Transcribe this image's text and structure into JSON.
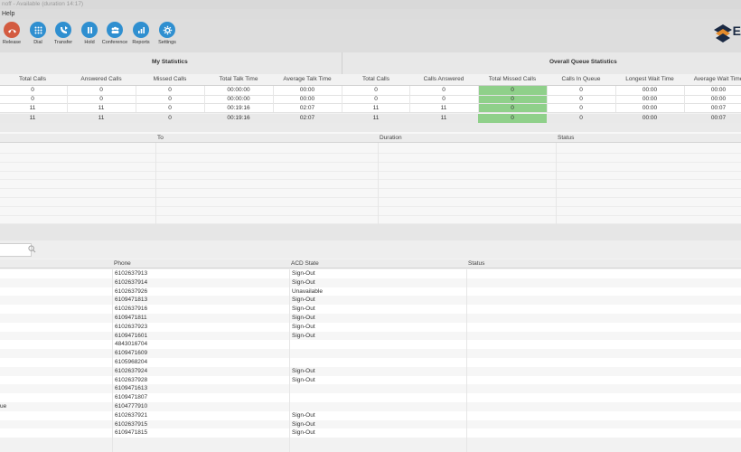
{
  "window": {
    "title": "noff - Available (duration 14:17)"
  },
  "menu": {
    "help": "Help"
  },
  "toolbar": {
    "buttons": [
      {
        "label": "Release",
        "icon": "release-phone-icon"
      },
      {
        "label": "Dial",
        "icon": "dialpad-icon"
      },
      {
        "label": "Transfer",
        "icon": "transfer-icon"
      },
      {
        "label": "Hold",
        "icon": "hold-icon"
      },
      {
        "label": "Conference",
        "icon": "conference-icon"
      },
      {
        "label": "Reports",
        "icon": "reports-icon"
      },
      {
        "label": "Settings",
        "icon": "gear-icon"
      }
    ],
    "logo_letter": "E"
  },
  "stats": {
    "my_title": "My Statistics",
    "queue_title": "Overall Queue Statistics",
    "columns": [
      "Total Calls",
      "Answered Calls",
      "Missed Calls",
      "Total Talk Time",
      "Average Talk Time",
      "Total Calls",
      "Calls Answered",
      "Total Missed Calls",
      "Calls In Queue",
      "Longest Wait Time",
      "Average Wait Time"
    ],
    "rows": [
      [
        "0",
        "0",
        "0",
        "00:00:00",
        "00:00",
        "0",
        "0",
        "0",
        "0",
        "00:00",
        "00:00"
      ],
      [
        "0",
        "0",
        "0",
        "00:00:00",
        "00:00",
        "0",
        "0",
        "0",
        "0",
        "00:00",
        "00:00"
      ],
      [
        "11",
        "11",
        "0",
        "00:19:16",
        "02:07",
        "11",
        "11",
        "0",
        "0",
        "00:00",
        "00:07"
      ]
    ],
    "totals": [
      "11",
      "11",
      "0",
      "00:19:16",
      "02:07",
      "11",
      "11",
      "0",
      "0",
      "00:00",
      "00:07"
    ],
    "highlight_color": "#8fd08a"
  },
  "calls": {
    "columns": {
      "to": "To",
      "duration": "Duration",
      "status": "Status"
    }
  },
  "agents": {
    "search_placeholder": "",
    "columns": {
      "phone": "Phone",
      "acd_state": "ACD State",
      "status": "Status"
    },
    "rows": [
      {
        "name": "",
        "phone": "6102637913",
        "acd": "Sign-Out"
      },
      {
        "name": "",
        "phone": "6102637914",
        "acd": "Sign-Out"
      },
      {
        "name": "",
        "phone": "6102637926",
        "acd": "Unavailable"
      },
      {
        "name": "",
        "phone": "6109471813",
        "acd": "Sign-Out"
      },
      {
        "name": "",
        "phone": "6102637916",
        "acd": "Sign-Out"
      },
      {
        "name": "",
        "phone": "6109471811",
        "acd": "Sign-Out"
      },
      {
        "name": "",
        "phone": "6102637923",
        "acd": "Sign-Out"
      },
      {
        "name": "",
        "phone": "6109471601",
        "acd": "Sign-Out"
      },
      {
        "name": "",
        "phone": "4843016704",
        "acd": ""
      },
      {
        "name": "",
        "phone": "6109471609",
        "acd": ""
      },
      {
        "name": "",
        "phone": "6105968204",
        "acd": ""
      },
      {
        "name": "",
        "phone": "6102637924",
        "acd": "Sign-Out"
      },
      {
        "name": "",
        "phone": "6102637928",
        "acd": "Sign-Out"
      },
      {
        "name": "",
        "phone": "6109471613",
        "acd": ""
      },
      {
        "name": "",
        "phone": "6109471807",
        "acd": ""
      },
      {
        "name": "ue",
        "phone": "6104777910",
        "acd": ""
      },
      {
        "name": "",
        "phone": "6102637921",
        "acd": "Sign-Out"
      },
      {
        "name": "",
        "phone": "6102637915",
        "acd": "Sign-Out"
      },
      {
        "name": "",
        "phone": "6109471815",
        "acd": "Sign-Out"
      }
    ]
  }
}
